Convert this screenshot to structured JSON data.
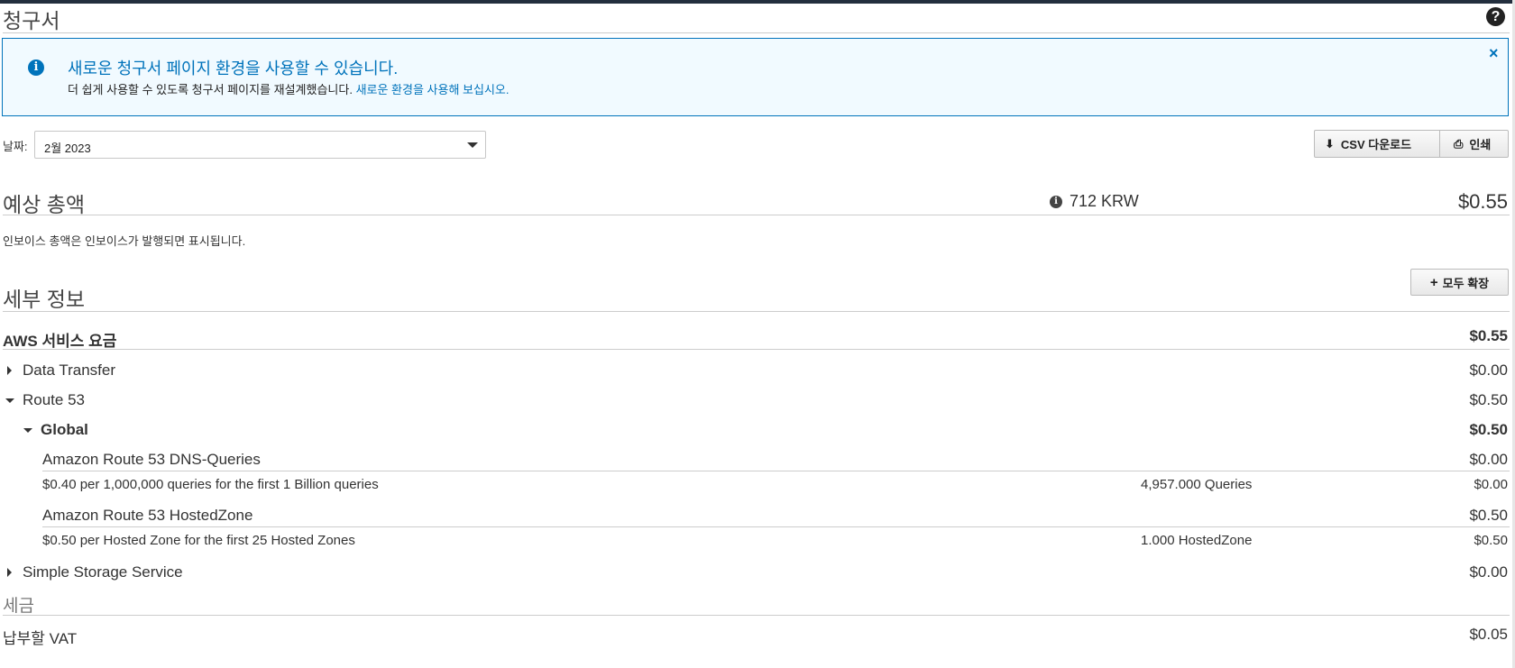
{
  "page": {
    "title": "청구서"
  },
  "banner": {
    "title": "새로운 청구서 페이지 환경을 사용할 수 있습니다.",
    "text": "더 쉽게 사용할 수 있도록 청구서 페이지를 재설계했습니다.",
    "link": "새로운 환경을 사용해 보십시오.",
    "close": "×"
  },
  "filter": {
    "date_label": "날짜:",
    "date_value": "2월 2023"
  },
  "toolbar": {
    "csv_label": "CSV 다운로드",
    "print_label": "인쇄"
  },
  "estimate": {
    "title": "예상 총액",
    "krw": "712 KRW",
    "total": "$0.55",
    "note": "인보이스 총액은 인보이스가 발행되면 표시됩니다."
  },
  "details": {
    "title": "세부 정보",
    "expand_all": "모두 확장",
    "aws_services_label": "AWS 서비스 요금",
    "aws_services_total": "$0.55",
    "services": [
      {
        "name": "Data Transfer",
        "amount": "$0.00",
        "expanded": false
      },
      {
        "name": "Route 53",
        "amount": "$0.50",
        "expanded": true,
        "regions": [
          {
            "name": "Global",
            "amount": "$0.50",
            "items": [
              {
                "name": "Amazon Route 53 DNS-Queries",
                "amount": "$0.00",
                "rate": "$0.40 per 1,000,000 queries for the first 1 Billion queries",
                "usage": "4,957.000 Queries",
                "rate_amount": "$0.00"
              },
              {
                "name": "Amazon Route 53 HostedZone",
                "amount": "$0.50",
                "rate": "$0.50 per Hosted Zone for the first 25 Hosted Zones",
                "usage": "1.000 HostedZone",
                "rate_amount": "$0.50"
              }
            ]
          }
        ]
      },
      {
        "name": "Simple Storage Service",
        "amount": "$0.00",
        "expanded": false
      }
    ]
  },
  "tax": {
    "title": "세금",
    "vat_label": "납부할 VAT",
    "vat_amount": "$0.05"
  }
}
